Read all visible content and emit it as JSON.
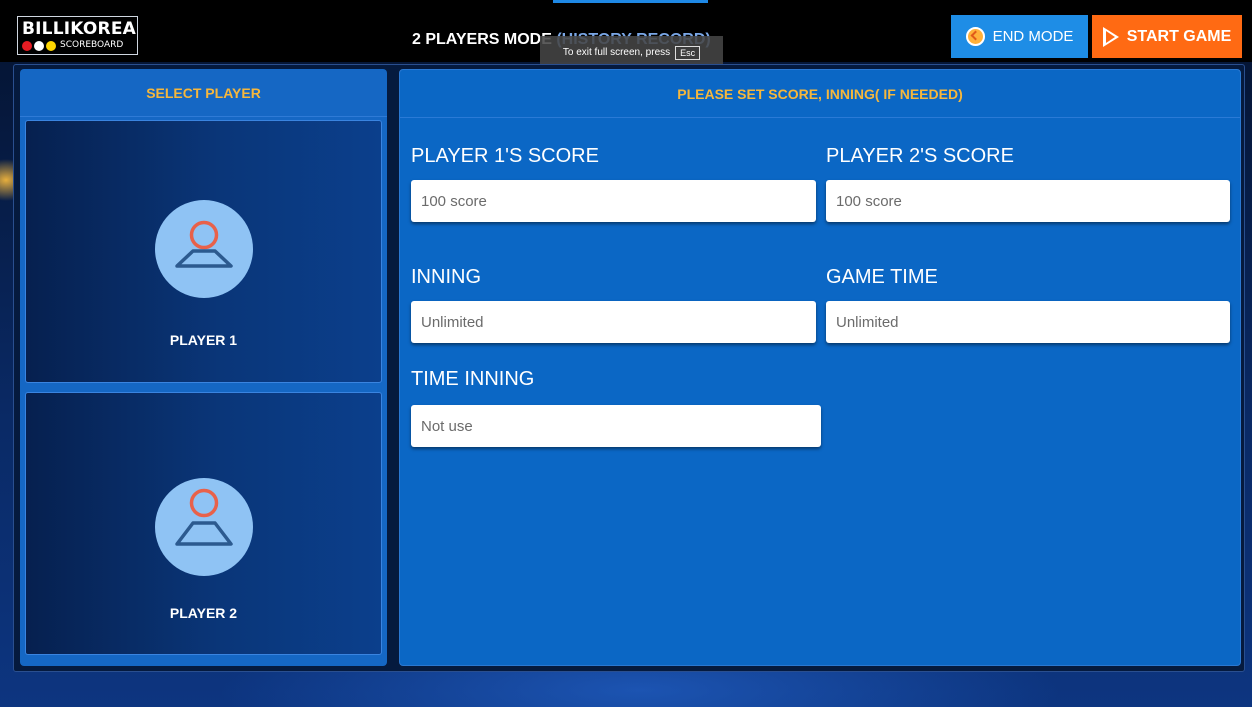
{
  "header": {
    "logo_text": "BILLIKOREA",
    "logo_sub": "SCOREBOARD",
    "logo_dot_colors": [
      "#e51c23",
      "#ffffff",
      "#ffd600"
    ],
    "mode_title": "2 PLAYERS MODE",
    "mode_sub": "(HISTORY RECORD)",
    "fullscreen_tip": "To exit full screen, press",
    "fullscreen_key": "Esc",
    "end_mode_label": "END MODE",
    "start_game_label": "START GAME"
  },
  "colors": {
    "accent_orange": "#ff6a13",
    "accent_blue": "#1e8de6",
    "heading_gold": "#f6b73c",
    "panel_blue": "#0b67c5"
  },
  "left_panel": {
    "title": "SELECT PLAYER",
    "players": [
      {
        "name": "PLAYER 1",
        "icon": "user-avatar-icon"
      },
      {
        "name": "PLAYER 2",
        "icon": "user-avatar-icon"
      }
    ]
  },
  "right_panel": {
    "title": "PLEASE SET SCORE, INNING( IF NEEDED)",
    "fields": {
      "p1_score": {
        "label": "PLAYER 1'S SCORE",
        "value": "100 score"
      },
      "p2_score": {
        "label": "PLAYER 2'S SCORE",
        "value": "100 score"
      },
      "inning": {
        "label": "INNING",
        "value": "Unlimited"
      },
      "game_time": {
        "label": "GAME TIME",
        "value": "Unlimited"
      },
      "time_inning": {
        "label": "TIME INNING",
        "value": "Not use"
      }
    }
  }
}
